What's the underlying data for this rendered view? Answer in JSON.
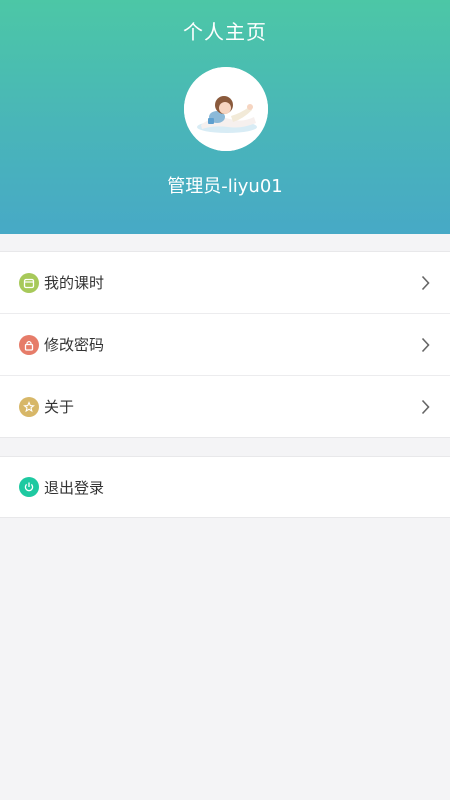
{
  "header": {
    "title": "个人主页",
    "username": "管理员-liyu01"
  },
  "menu": {
    "items": [
      {
        "label": "我的课时",
        "icon": "calendar-icon",
        "color": "#a7c95a"
      },
      {
        "label": "修改密码",
        "icon": "lock-icon",
        "color": "#e67c69"
      },
      {
        "label": "关于",
        "icon": "star-icon",
        "color": "#d7b768"
      }
    ]
  },
  "logout": {
    "label": "退出登录",
    "icon": "power-icon",
    "color": "#1ec9a1"
  },
  "colors": {
    "header_top": "#4cc7a6",
    "header_bottom": "#47a9c6",
    "background": "#f4f4f6"
  }
}
